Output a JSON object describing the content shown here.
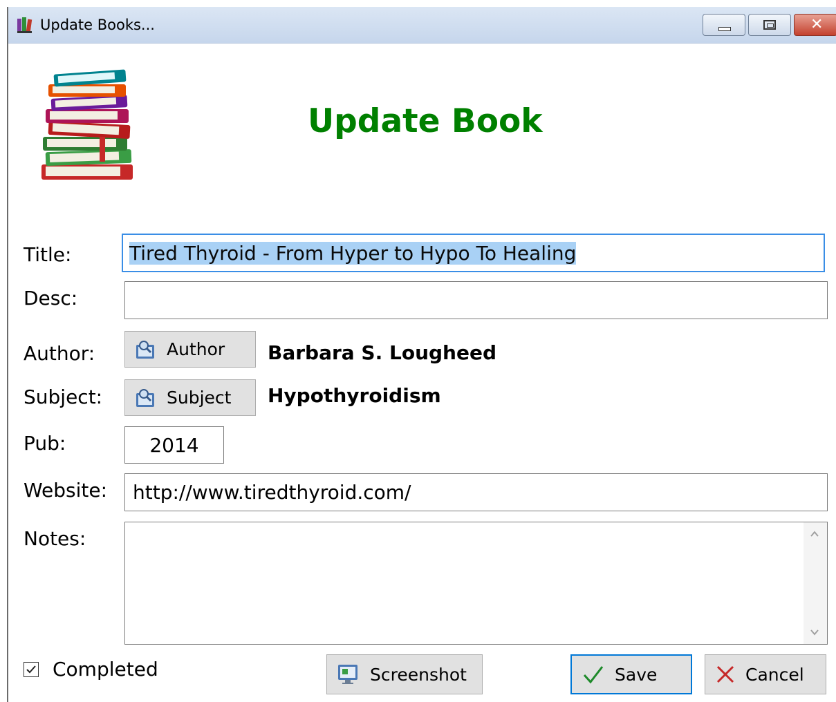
{
  "window": {
    "title": "Update Books...",
    "controls": {
      "minimize": "minimize",
      "maximize": "maximize",
      "close": "close"
    }
  },
  "header": {
    "heading": "Update Book",
    "logo_icon": "books-stack-icon"
  },
  "form": {
    "title_label": "Title:",
    "title_value": "Tired Thyroid - From Hyper to Hypo To Healing",
    "desc_label": "Desc:",
    "desc_value": "",
    "author_label": "Author:",
    "author_button": "Author",
    "author_value": "Barbara S. Lougheed",
    "subject_label": "Subject:",
    "subject_button": "Subject",
    "subject_value": "Hypothyroidism",
    "pub_label": "Pub:",
    "pub_value": "2014",
    "website_label": "Website:",
    "website_value": "http://www.tiredthyroid.com/",
    "notes_label": "Notes:",
    "notes_value": ""
  },
  "footer": {
    "completed_label": "Completed",
    "completed_checked": true,
    "screenshot_button": "Screenshot",
    "save_button": "Save",
    "cancel_button": "Cancel"
  },
  "colors": {
    "heading": "#008000",
    "focus": "#0078d7",
    "selection": "#a9d1f5"
  }
}
